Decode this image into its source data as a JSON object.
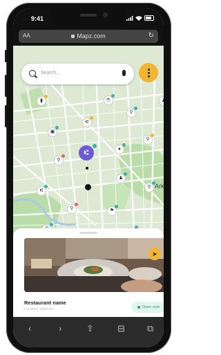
{
  "status_bar": {
    "time": "9:41"
  },
  "browser": {
    "text_size_label": "AA",
    "url": "Mapz.com",
    "reload_glyph": "↻"
  },
  "search": {
    "placeholder": "Search..."
  },
  "map": {
    "place_label": "Arka"
  },
  "sheet": {
    "restaurant_name": "Restaurant name",
    "location_address": "Location address",
    "status": "Open now"
  },
  "toolbar": {
    "back_glyph": "‹",
    "forward_glyph": "›",
    "share_glyph": "⇪",
    "bookmarks_glyph": "⊟",
    "tabs_glyph": "⧉"
  },
  "colors": {
    "accent": "#f2b530",
    "focus_pin": "#6b5bd6",
    "open_status": "#2f9c76"
  }
}
